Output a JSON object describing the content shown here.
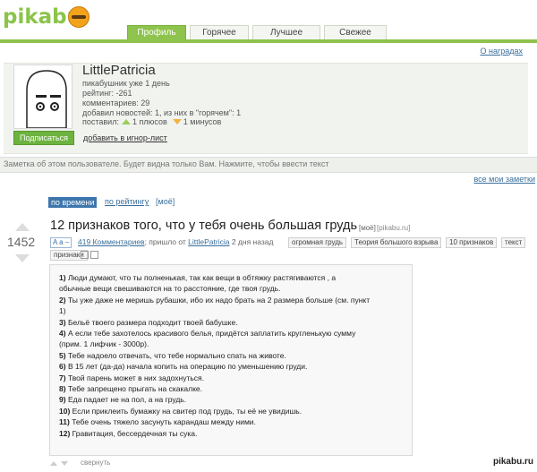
{
  "header": {
    "logo": "pikabu",
    "tabs": [
      {
        "label": "Профиль",
        "active": true
      },
      {
        "label": "Горячее",
        "active": false
      },
      {
        "label": "Лучшее",
        "active": false
      },
      {
        "label": "Свежее",
        "active": false
      }
    ],
    "awards_link": "О наградах"
  },
  "profile": {
    "username": "LittlePatricia",
    "since": "пикабушник уже 1 день",
    "rating": "рейтинг: -261",
    "comments": "комментариев: 29",
    "news": "добавил новостей: 1, из них в \"горячем\": 1",
    "votes_prefix": "поставил:",
    "plus": "1 плюсов",
    "minus": "1 минусов",
    "subscribe": "Подписаться",
    "ignore": "добавить в игнор-лист"
  },
  "note": {
    "text": "Заметка об этом пользователе. Будет видна только Вам. Нажмите, чтобы ввести текст",
    "all_notes": "все мои заметки"
  },
  "sort": {
    "by_time": "по времени",
    "by_rating": "по рейтингу",
    "mine": "[моё]"
  },
  "post": {
    "rating": "1452",
    "title": "12 признаков того, что у тебя очень большая грудь",
    "title_mine": "[моё]",
    "domain": "[pikabu.ru]",
    "aa": "A a –",
    "comments_link": "419 Комментариев",
    "posted_prefix": "; пришло от",
    "author": "LittlePatricia",
    "time": "2 дня назад",
    "tags": [
      "огромная грудь",
      "Теория большого взрыва",
      "10 признаков",
      "текст",
      "признаки"
    ],
    "lines": [
      {
        "num": "1)",
        "text": "Люди думают, что ты полненькая, так как вещи в обтяжку растягиваются , а"
      },
      {
        "num": "",
        "text": "обычные вещи свешиваются на то расстояние, где твоя грудь."
      },
      {
        "num": "2)",
        "text": "Ты уже даже не меришь рубашки, ибо их надо брать на 2 размера больше (см. пункт"
      },
      {
        "num": "",
        "text": "1)"
      },
      {
        "num": "3)",
        "text": "Бельё твоего размера подходит твоей бабушке."
      },
      {
        "num": "4)",
        "text": "А если тебе захотелось красивого белья, придётся заплатить кругленькую сумму"
      },
      {
        "num": "",
        "text": "(прим. 1 лифчик - 3000р)."
      },
      {
        "num": "5)",
        "text": "Тебе надоело отвечать, что тебе нормально спать на животе."
      },
      {
        "num": "6)",
        "text": "В 15 лет (да-да) начала копить на операцию по уменьшению груди."
      },
      {
        "num": "7)",
        "text": "Твой парень может в них задохнуться."
      },
      {
        "num": "8)",
        "text": "Тебе запрещено прыгать на скакалке."
      },
      {
        "num": "9)",
        "text": "Еда падает не на пол, а на грудь."
      },
      {
        "num": "10)",
        "text": "Если приклеить бумажку на свитер под грудь, ты её не увидишь."
      },
      {
        "num": "11)",
        "text": "Тебе очень тяжело засунуть карандаш между ними."
      },
      {
        "num": "12)",
        "text": "Гравитация, бессердечная ты сука."
      }
    ],
    "collapse": "свернуть"
  },
  "watermark": "pikabu.ru",
  "colors": {
    "brand_green": "#8ec34d",
    "link_blue": "#3a6f9c",
    "sort_active": "#3d76ad",
    "plus": "#9ccf5a",
    "minus": "#f2b441"
  }
}
